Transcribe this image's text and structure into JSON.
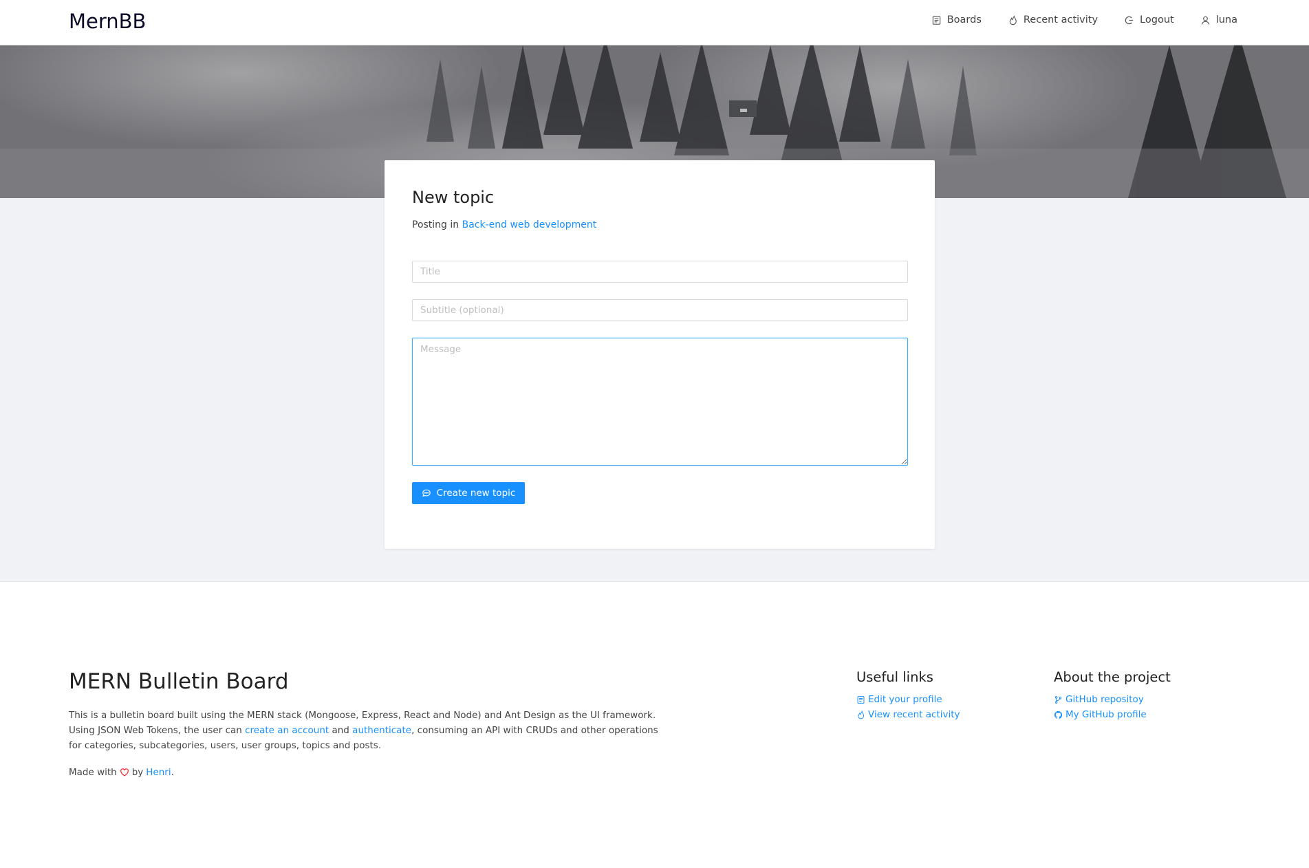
{
  "header": {
    "brand": "MernBB",
    "nav": [
      {
        "label": "Boards",
        "icon": "boards-icon"
      },
      {
        "label": "Recent activity",
        "icon": "fire-icon"
      },
      {
        "label": "Logout",
        "icon": "logout-icon"
      },
      {
        "label": "luna",
        "icon": "user-icon"
      }
    ]
  },
  "form": {
    "title": "New topic",
    "posting_prefix": "Posting in",
    "board_link": "Back-end web development",
    "title_placeholder": "Title",
    "subtitle_placeholder": "Subtitle (optional)",
    "message_placeholder": "Message",
    "submit_label": "Create new topic"
  },
  "footer": {
    "title": "MERN Bulletin Board",
    "desc_part1": "This is a bulletin board built using the MERN stack (Mongoose, Express, React and Node) and Ant Design as the UI framework. Using JSON Web Tokens, the user can ",
    "desc_link1": "create an account",
    "desc_part2": " and ",
    "desc_link2": "authenticate",
    "desc_part3": ", consuming an API with CRUDs and other operations for categories, subcategories, users, user groups, topics and posts.",
    "made_with": "Made with",
    "by": "by",
    "author": "Henri",
    "period": ".",
    "useful_links_title": "Useful links",
    "useful_links": [
      "Edit your profile",
      "View recent activity"
    ],
    "about_title": "About the project",
    "about_links": [
      "GitHub repositoy",
      "My GitHub profile"
    ]
  },
  "colors": {
    "accent": "#1890ff",
    "heart": "#f5222d",
    "page_bg": "#f0f2f5"
  }
}
